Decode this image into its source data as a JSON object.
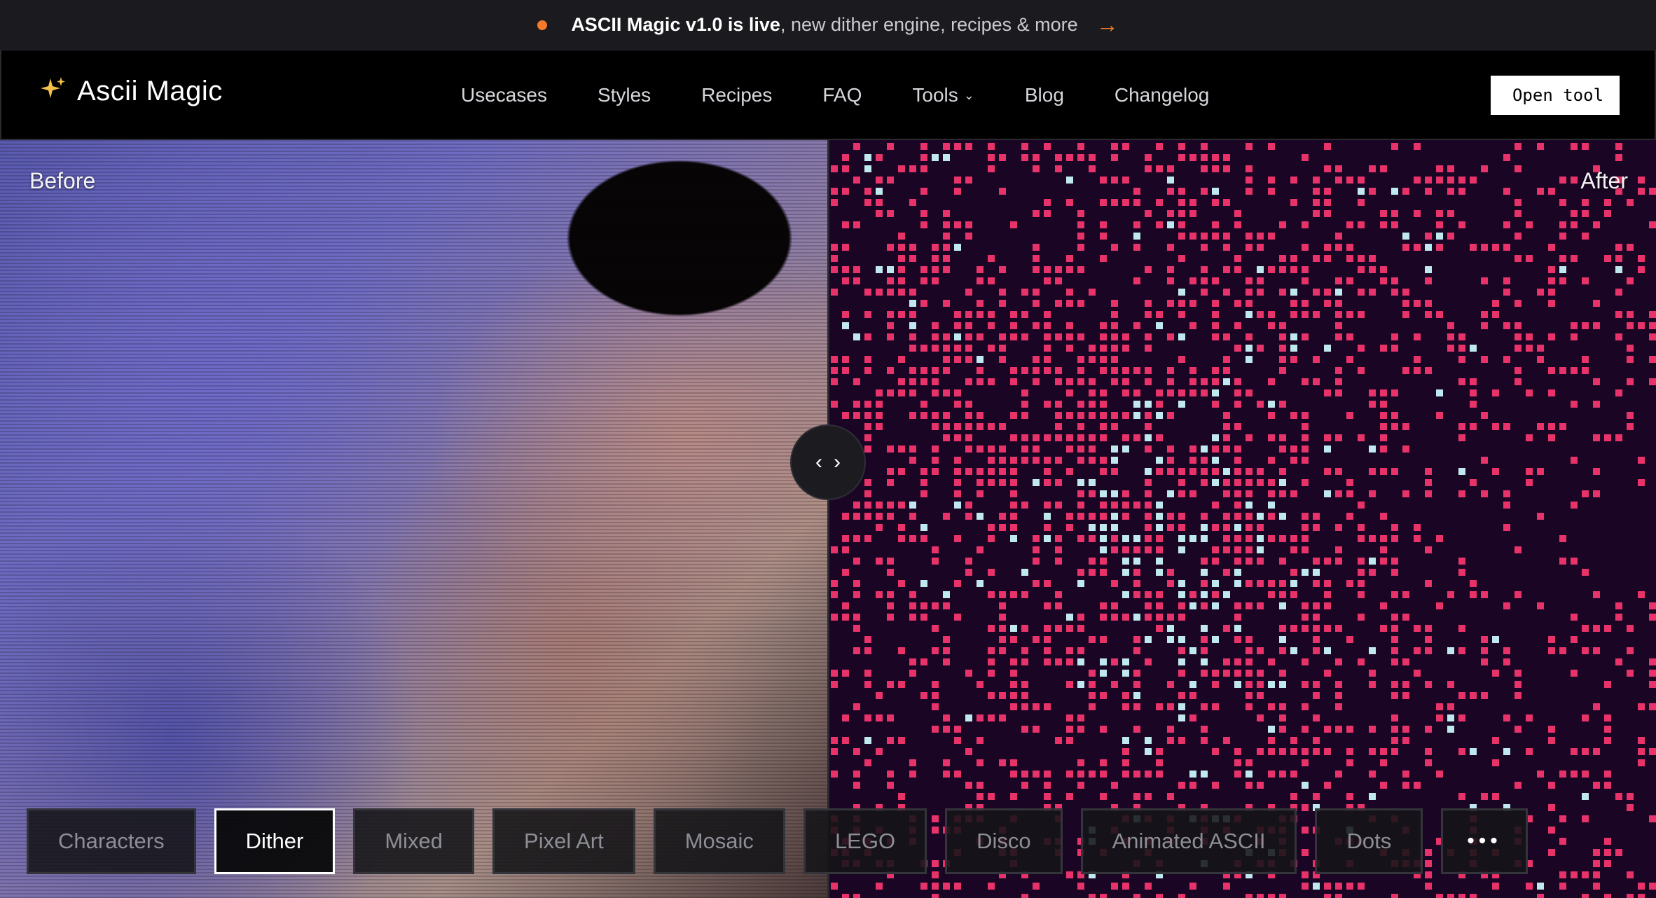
{
  "announcement": {
    "strong_text": "ASCII Magic v1.0 is live",
    "rest_text": ", new dither engine, recipes & more",
    "arrow": "→",
    "dot_color": "#f47a2c"
  },
  "nav": {
    "brand": "Ascii Magic",
    "brand_icon": "sparkle-icon",
    "links": [
      "Usecases",
      "Styles",
      "Recipes",
      "FAQ",
      "Tools",
      "Blog",
      "Changelog"
    ],
    "tools_caret": "⌄",
    "cta": "Open tool"
  },
  "compare": {
    "before_label": "Before",
    "after_label": "After",
    "handle_left": "‹",
    "handle_right": "›",
    "after_palette": [
      "#1a0524",
      "#e8326a",
      "#bfe9ee"
    ]
  },
  "styles": {
    "chips": [
      "Characters",
      "Dither",
      "Mixed",
      "Pixel Art",
      "Mosaic",
      "LEGO",
      "Disco",
      "Animated ASCII",
      "Dots"
    ],
    "active": "Dither",
    "more": "•••"
  }
}
